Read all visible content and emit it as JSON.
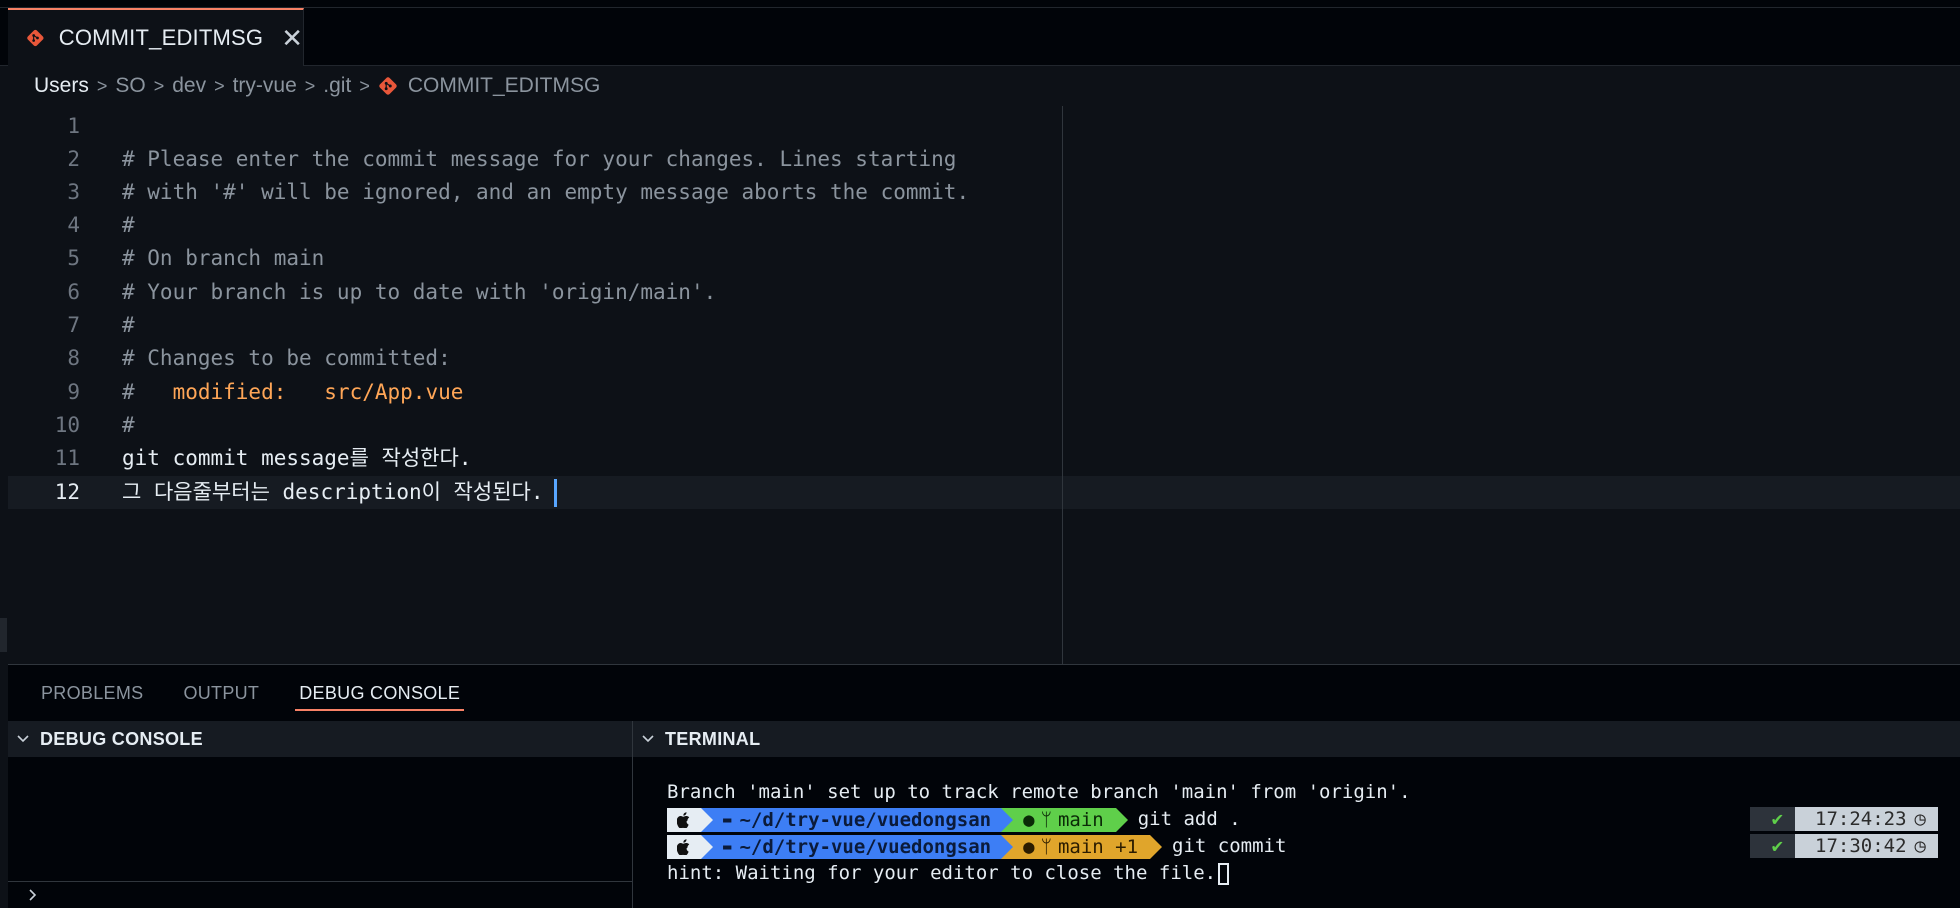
{
  "tab": {
    "filename": "COMMIT_EDITMSG",
    "close_glyph": "✕",
    "icon": "git-file-icon"
  },
  "breadcrumb": {
    "items": [
      "Users",
      "SO",
      "dev",
      "try-vue",
      ".git",
      "COMMIT_EDITMSG"
    ]
  },
  "editor": {
    "lines": [
      {
        "num": "1",
        "text": ""
      },
      {
        "num": "2",
        "text": "# Please enter the commit message for your changes. Lines starting"
      },
      {
        "num": "3",
        "text": "# with '#' will be ignored, and an empty message aborts the commit."
      },
      {
        "num": "4",
        "text": "#"
      },
      {
        "num": "5",
        "text": "# On branch main"
      },
      {
        "num": "6",
        "text": "# Your branch is up to date with 'origin/main'."
      },
      {
        "num": "7",
        "text": "#"
      },
      {
        "num": "8",
        "text": "# Changes to be committed:"
      },
      {
        "num": "9",
        "prefix": "#   ",
        "text": "modified:   src/App.vue"
      },
      {
        "num": "10",
        "text": "#"
      },
      {
        "num": "11",
        "text": "git commit message를 작성한다."
      },
      {
        "num": "12",
        "text": "그 다음줄부터는 description이 작성된다."
      }
    ],
    "current_line": "12"
  },
  "panel": {
    "tabs": [
      "PROBLEMS",
      "OUTPUT",
      "DEBUG CONSOLE"
    ],
    "active_tab": "DEBUG CONSOLE",
    "debug_header": "DEBUG CONSOLE",
    "terminal_header": "TERMINAL"
  },
  "terminal": {
    "line1": "Branch 'main' set up to track remote branch 'main' from 'origin'.",
    "prompt1": {
      "dir": "~/d/try-vue/vuedongsan",
      "branch": "main",
      "command": "git add .",
      "status": "✔",
      "time": "17:24:23"
    },
    "prompt2": {
      "dir": "~/d/try-vue/vuedongsan",
      "branch": "main +1",
      "command": "git commit",
      "status": "✔",
      "time": "17:30:42"
    },
    "hint": "hint: Waiting for your editor to close the file."
  },
  "colors": {
    "accent": "#f78166",
    "cursor": "#58a6ff",
    "modified": "#ffa657",
    "git_icon": "#e8573a",
    "prompt_dir": "#3d7ef5",
    "prompt_git_clean": "#5fcf4a",
    "prompt_git_dirty": "#e0a52b"
  }
}
